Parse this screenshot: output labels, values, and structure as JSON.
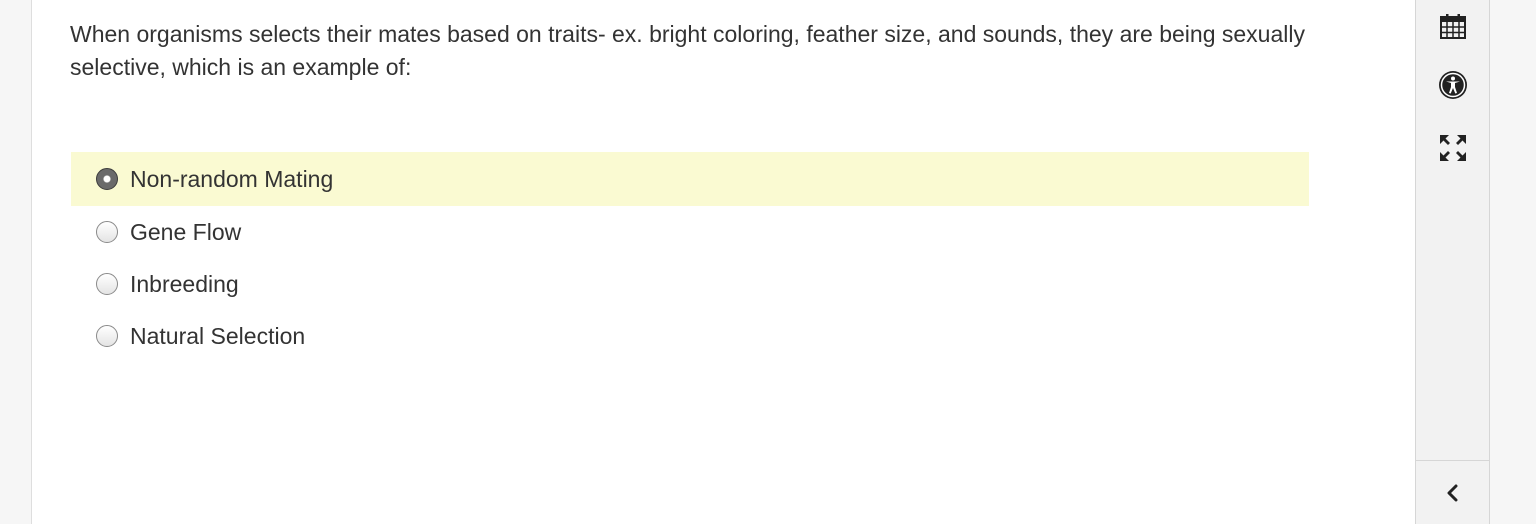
{
  "question": {
    "text": "When organisms selects their mates based on traits- ex. bright coloring, feather size, and sounds, they are being sexually selective, which is an example of:"
  },
  "choices": [
    {
      "label": "Non-random Mating",
      "selected": true
    },
    {
      "label": "Gene Flow",
      "selected": false
    },
    {
      "label": "Inbreeding",
      "selected": false
    },
    {
      "label": "Natural Selection",
      "selected": false
    }
  ],
  "toolbar": {
    "tools": [
      {
        "icon": "calendar-icon"
      },
      {
        "icon": "accessibility-icon"
      },
      {
        "icon": "expand-icon"
      }
    ],
    "collapse_icon": "chevron-left-icon"
  },
  "colors": {
    "selected_highlight": "#fafad2",
    "text": "#333333",
    "toolbar_bg": "#f2f2f2"
  }
}
